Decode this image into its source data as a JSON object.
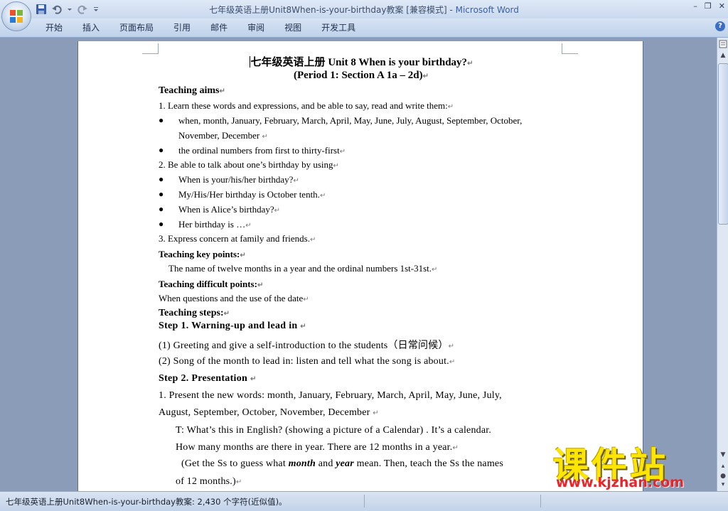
{
  "window": {
    "title_prefix": "七年级英语上册Unit8When-is-your-birthday教案 [兼容模式] - ",
    "title_app": "Microsoft Word",
    "controls": [
      "–",
      "❐",
      "✕"
    ]
  },
  "ribbon": {
    "tabs": [
      "开始",
      "插入",
      "页面布局",
      "引用",
      "邮件",
      "审阅",
      "视图",
      "开发工具"
    ],
    "help": "?"
  },
  "document": {
    "title_cn": "七年级英语上册",
    "title_en": " Unit 8 When is your birthday?",
    "subtitle": "(Period 1: Section A 1a – 2d)",
    "aims_heading": "Teaching aims",
    "aim1": "1. Learn these words and expressions, and be able to say, read and write them:",
    "bullet_words": "when,  month,  January,  February,  March,  April,  May,  June,  July,  August,  September,  October,",
    "bullet_words_cont": "November, December",
    "bullet_ordinals": "the ordinal numbers from first to thirty-first",
    "aim2": "2. Be able to talk about one’s birthday by using",
    "b1": "When is your/his/her birthday?",
    "b2": "My/His/Her birthday is October tenth.",
    "b3": "When is Alice’s birthday?",
    "b4": "Her birthday is …",
    "aim3": "3. Express concern at family and friends.",
    "key_heading": "Teaching key points:",
    "key_text": "The name of twelve months in a year and the ordinal numbers 1st-31st.",
    "diff_heading": "Teaching difficult points:",
    "diff_text": "When questions and the use of the date",
    "steps_heading": "Teaching steps:",
    "step1": "Step 1. Warning-up and lead in",
    "s1_1": "(1) Greeting and give a self-introduction to the students（日常问候）",
    "s1_2": "(2) Song of the month to lead in: listen and tell what the song is about.",
    "step2": "Step 2. Presentation",
    "s2_1a": "1. Present the new words: month, January, February, March, April, May, June, July,",
    "s2_1b": "August, September, October, November, December",
    "t_line1": "T:  What’s this in English? (showing a picture of a Calendar) . It’s a calendar.",
    "t_line2": "How many months are there in year. There are 12 months in a year.",
    "g_pre": "(Get the Ss to guess what ",
    "g_month": "month",
    "g_and": " and ",
    "g_year": "year",
    "g_post": " mean. Then, teach the Ss the names",
    "g_line2": "of 12 months.)"
  },
  "status": {
    "text": "七年级英语上册Unit8When-is-your-birthday教案: 2,430 个字符(近似值)。"
  },
  "watermark": {
    "big": "课件站",
    "url": "www.kjzhan.com"
  }
}
